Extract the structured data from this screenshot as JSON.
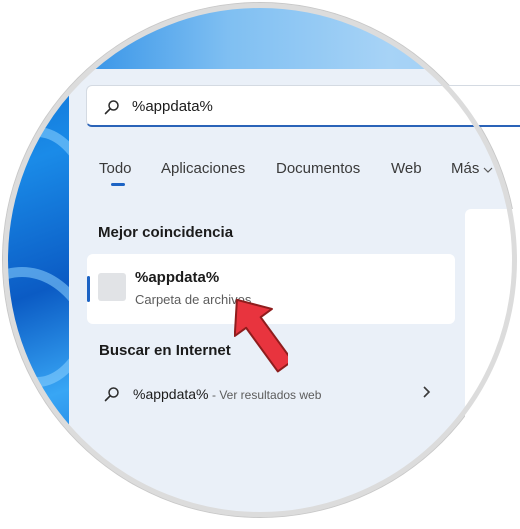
{
  "search": {
    "query": "%appdata%"
  },
  "tabs": [
    {
      "label": "Todo",
      "active": true
    },
    {
      "label": "Aplicaciones"
    },
    {
      "label": "Documentos"
    },
    {
      "label": "Web"
    },
    {
      "label": "Más"
    }
  ],
  "best_match": {
    "heading": "Mejor coincidencia",
    "title": "%appdata%",
    "subtitle": "Carpeta de archivos"
  },
  "internet": {
    "heading": "Buscar en Internet",
    "query": "%appdata%",
    "suffix": "- Ver resultados web"
  },
  "colors": {
    "accent": "#1c63c4",
    "pointer": "#e8343e"
  },
  "icons": [
    "search-icon",
    "folder-icon",
    "chevron-right-icon",
    "chevron-down-icon",
    "pointer-arrow-icon"
  ]
}
